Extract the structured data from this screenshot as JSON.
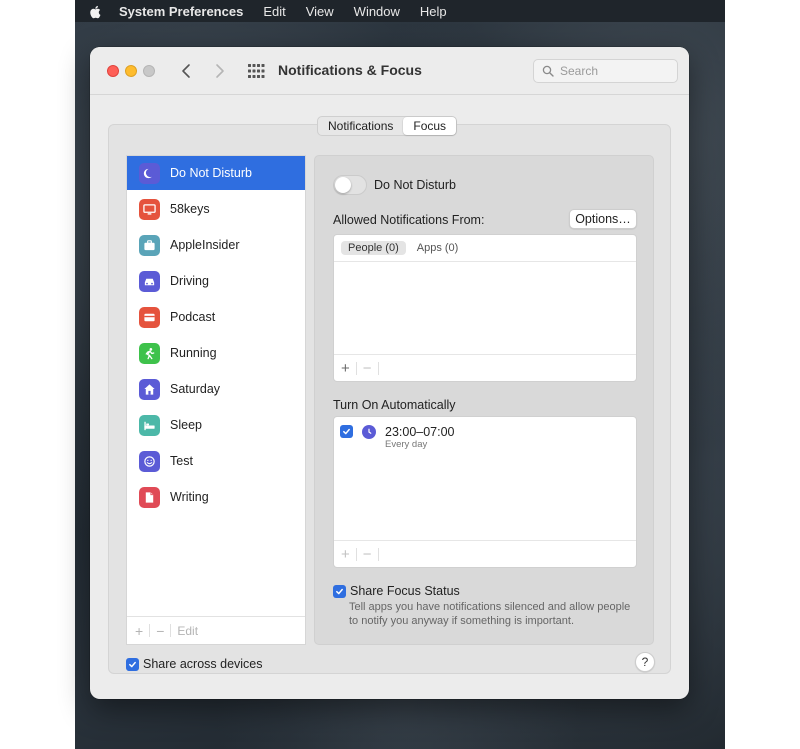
{
  "menubar": {
    "app_name": "System Preferences",
    "items": [
      "Edit",
      "View",
      "Window",
      "Help"
    ]
  },
  "window": {
    "title": "Notifications & Focus",
    "search_placeholder": "Search"
  },
  "segments": {
    "notifications": "Notifications",
    "focus": "Focus",
    "selected": "Focus"
  },
  "sidebar": {
    "items": [
      {
        "label": "Do Not Disturb",
        "icon": "moon-icon",
        "color": "#5b5bd6",
        "selected": true
      },
      {
        "label": "58keys",
        "icon": "monitor-icon",
        "color": "#e5533d"
      },
      {
        "label": "AppleInsider",
        "icon": "briefcase-icon",
        "color": "#5aa4b8"
      },
      {
        "label": "Driving",
        "icon": "car-icon",
        "color": "#5b5bd6"
      },
      {
        "label": "Podcast",
        "icon": "card-icon",
        "color": "#e5533d"
      },
      {
        "label": "Running",
        "icon": "runner-icon",
        "color": "#3ec24b"
      },
      {
        "label": "Saturday",
        "icon": "house-icon",
        "color": "#5b5bd6"
      },
      {
        "label": "Sleep",
        "icon": "bed-icon",
        "color": "#4cb8a8"
      },
      {
        "label": "Test",
        "icon": "smiley-icon",
        "color": "#5b5bd6"
      },
      {
        "label": "Writing",
        "icon": "document-icon",
        "color": "#e04a56"
      }
    ],
    "footer": {
      "add": "+",
      "remove": "−",
      "edit": "Edit"
    }
  },
  "panel": {
    "focus_name": "Do Not Disturb",
    "toggle_on": false,
    "allowed_label": "Allowed Notifications From:",
    "options_button": "Options…",
    "tabs": {
      "people": "People (0)",
      "apps": "Apps (0)"
    },
    "footer": {
      "add": "+",
      "remove": "−"
    },
    "turn_on_label": "Turn On Automatically",
    "schedule": {
      "time": "23:00–07:00",
      "repeat": "Every day",
      "enabled": true
    },
    "share_focus": {
      "label": "Share Focus Status",
      "checked": true,
      "description": "Tell apps you have notifications silenced and allow people to notify you anyway if something is important."
    }
  },
  "bottom": {
    "share_devices": "Share across devices",
    "share_devices_checked": true,
    "help": "?"
  },
  "colors": {
    "accent": "#2f6ee0",
    "close": "#fe5f57",
    "minimize": "#febc2e"
  }
}
